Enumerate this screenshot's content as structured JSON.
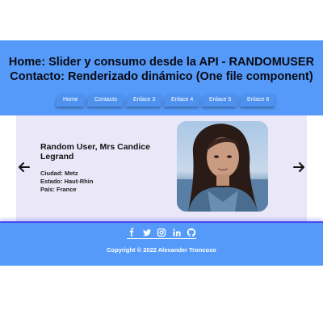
{
  "header": {
    "title_line1": "Home: Slider y consumo desde la API - RANDOMUSER",
    "title_line2": "Contacto: Renderizado dinámico (One file component)",
    "nav": [
      "Home",
      "Contacto",
      "Enlace 3",
      "Enlace 4",
      "Enlace 5",
      "Enlace 6"
    ]
  },
  "slider": {
    "user_name": "Random User, Mrs Candice Legrand",
    "ciudad": "Ciudad: Metz",
    "estado": "Estado: Haut-Rhin",
    "pais": "País: France",
    "prev_icon": "arrow-left-icon",
    "next_icon": "arrow-right-icon"
  },
  "footer": {
    "social_icons": [
      "facebook-icon",
      "twitter-icon",
      "instagram-icon",
      "linkedin-icon",
      "github-icon"
    ],
    "copyright": "Copyright © 2022 Alexander Troncoso"
  },
  "colors": {
    "header_bg": "#559af8",
    "nav_bg": "#4f91ef",
    "slider_bg": "#e9e7f8",
    "footer_accent": "#4a4aef"
  }
}
